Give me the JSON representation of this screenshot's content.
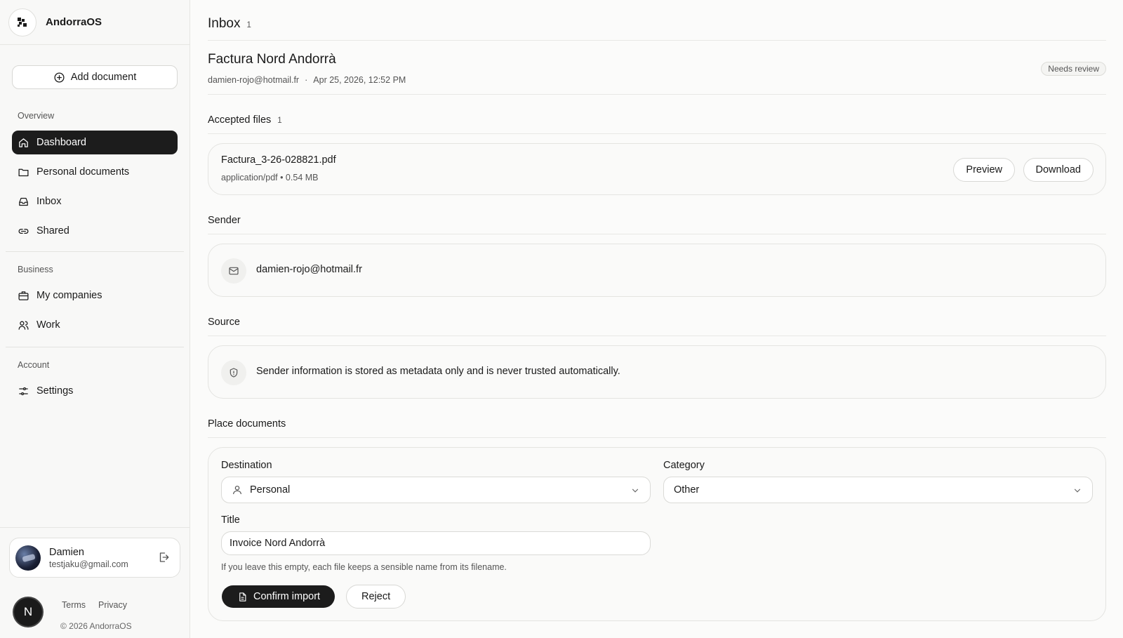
{
  "app": {
    "name": "AndorraOS"
  },
  "sidebar": {
    "add_document": "Add document",
    "sections": {
      "overview": "Overview",
      "business": "Business",
      "account": "Account"
    },
    "items": {
      "dashboard": "Dashboard",
      "personal_documents": "Personal documents",
      "inbox": "Inbox",
      "shared": "Shared",
      "my_companies": "My companies",
      "work": "Work",
      "settings": "Settings"
    },
    "user": {
      "name": "Damien",
      "email": "testjaku@gmail.com"
    },
    "badge_letter": "N",
    "footer": {
      "terms": "Terms",
      "privacy": "Privacy",
      "copyright": "© 2026 AndorraOS"
    }
  },
  "main": {
    "page_title": "Inbox",
    "page_count": "1",
    "document": {
      "title": "Factura Nord Andorrà",
      "sender": "damien-rojo@hotmail.fr",
      "separator": "·",
      "date": "Apr 25, 2026, 12:52 PM",
      "status": "Needs review"
    },
    "accepted_files": {
      "title": "Accepted files",
      "count": "1",
      "file_name": "Factura_3-26-028821.pdf",
      "file_meta": "application/pdf • 0.54 MB",
      "preview": "Preview",
      "download": "Download"
    },
    "sender": {
      "title": "Sender",
      "email": "damien-rojo@hotmail.fr"
    },
    "source": {
      "title": "Source",
      "note": "Sender information is stored as metadata only and is never trusted automatically."
    },
    "place": {
      "title": "Place documents",
      "destination_label": "Destination",
      "destination_value": "Personal",
      "category_label": "Category",
      "category_value": "Other",
      "title_label": "Title",
      "title_value": "Invoice Nord Andorrà",
      "hint": "If you leave this empty, each file keeps a sensible name from its filename.",
      "confirm": "Confirm import",
      "reject": "Reject"
    }
  }
}
